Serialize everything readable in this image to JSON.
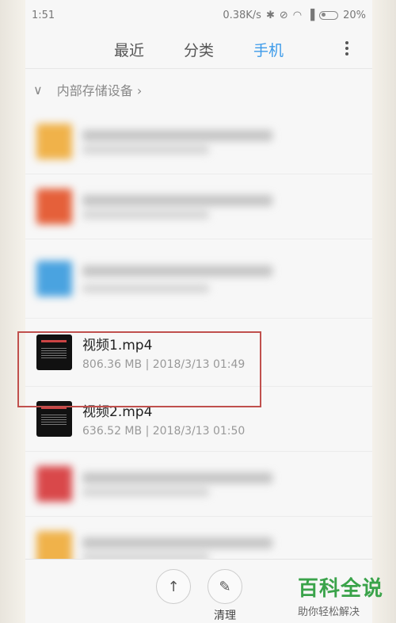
{
  "status": {
    "time": "1:51",
    "speed": "0.38K/s",
    "battery": "20%"
  },
  "tabs": [
    {
      "label": "最近",
      "active": false
    },
    {
      "label": "分类",
      "active": false
    },
    {
      "label": "手机",
      "active": true
    }
  ],
  "breadcrumb": {
    "path": "内部存储设备"
  },
  "files": [
    {
      "name": "视频1.mp4",
      "size": "806.36 MB",
      "date": "2018/3/13 01:49"
    },
    {
      "name": "视频2.mp4",
      "size": "636.52 MB",
      "date": "2018/3/13 01:50"
    }
  ],
  "bottom": {
    "clean_label": "清理"
  },
  "watermark": {
    "main": "百科全说",
    "sub": "助你轻松解决"
  },
  "colors": {
    "accent": "#3d9bea",
    "highlight": "#c0504d"
  }
}
